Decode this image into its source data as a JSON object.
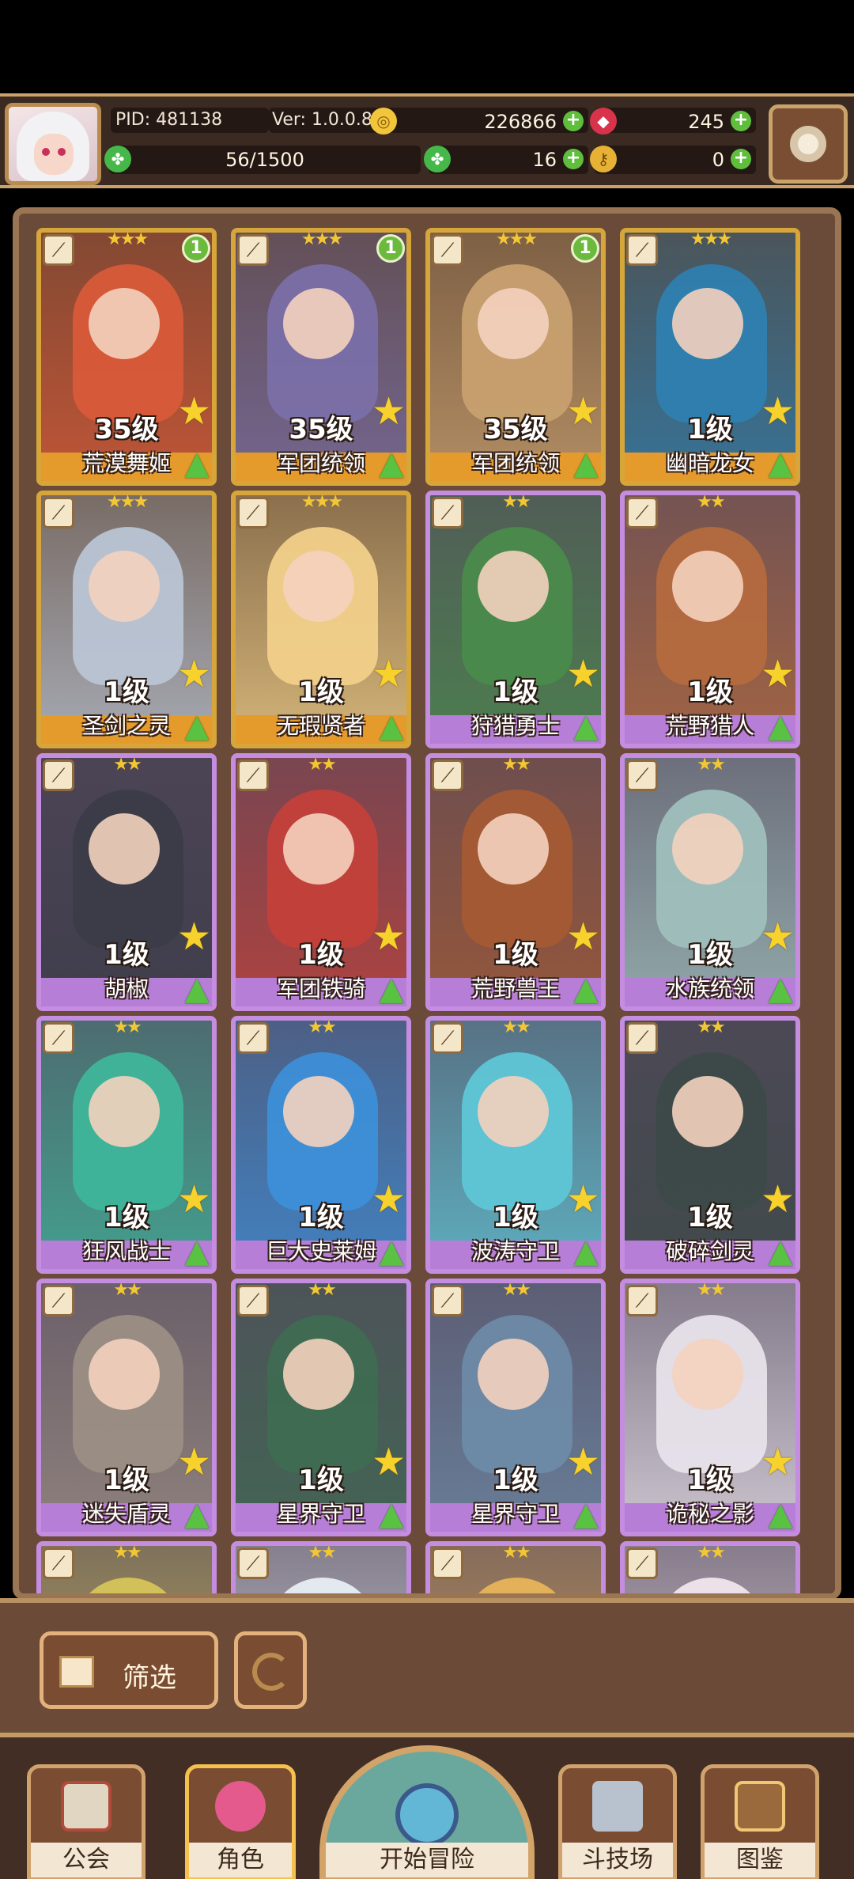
{
  "header": {
    "pid": "PID: 481138",
    "version": "Ver: 1.0.0.8",
    "gold": "226866",
    "gems": "245",
    "stamina": "56/1500",
    "clover": "16",
    "keys": "0",
    "plus": "+"
  },
  "icons": {
    "gold": "gold-coin-icon",
    "gem": "ruby-icon",
    "clover": "clover-icon",
    "key": "key-icon",
    "stamina": "stamina-clover-icon",
    "settings": "gear-icon"
  },
  "characters": [
    {
      "name": "荒漠舞姬",
      "level": "35级",
      "stars": "★★★",
      "badge": "1",
      "rarity": "gold",
      "tint": "#d85a3a"
    },
    {
      "name": "军团统领",
      "level": "35级",
      "stars": "★★★",
      "badge": "1",
      "rarity": "gold",
      "tint": "#7a6fa8"
    },
    {
      "name": "军团统领",
      "level": "35级",
      "stars": "★★★",
      "badge": "1",
      "rarity": "gold",
      "tint": "#c8a070"
    },
    {
      "name": "幽暗龙女",
      "level": "1级",
      "stars": "★★★",
      "badge": "",
      "rarity": "gold",
      "tint": "#2f7fb0"
    },
    {
      "name": "圣剑之灵",
      "level": "1级",
      "stars": "★★★",
      "badge": "",
      "rarity": "gold",
      "tint": "#b9c4d4"
    },
    {
      "name": "无瑕贤者",
      "level": "1级",
      "stars": "★★★",
      "badge": "",
      "rarity": "gold",
      "tint": "#f1d08a"
    },
    {
      "name": "狩猎勇士",
      "level": "1级",
      "stars": "★★",
      "badge": "",
      "rarity": "purple",
      "tint": "#4a8a4c"
    },
    {
      "name": "荒野猎人",
      "level": "1级",
      "stars": "★★",
      "badge": "",
      "rarity": "purple",
      "tint": "#b46a3e"
    },
    {
      "name": "胡椒",
      "level": "1级",
      "stars": "★★",
      "badge": "",
      "rarity": "purple",
      "tint": "#3b3c48"
    },
    {
      "name": "军团铁骑",
      "level": "1级",
      "stars": "★★",
      "badge": "",
      "rarity": "purple",
      "tint": "#c3413a"
    },
    {
      "name": "荒野兽王",
      "level": "1级",
      "stars": "★★",
      "badge": "",
      "rarity": "purple",
      "tint": "#a45a34"
    },
    {
      "name": "水族统领",
      "level": "1级",
      "stars": "★★",
      "badge": "",
      "rarity": "purple",
      "tint": "#9fbfbc"
    },
    {
      "name": "狂风战士",
      "level": "1级",
      "stars": "★★",
      "badge": "",
      "rarity": "purple",
      "tint": "#3fb59a"
    },
    {
      "name": "巨大史莱姆",
      "level": "1级",
      "stars": "★★",
      "badge": "",
      "rarity": "purple",
      "tint": "#3d8fd8"
    },
    {
      "name": "波涛守卫",
      "level": "1级",
      "stars": "★★",
      "badge": "",
      "rarity": "purple",
      "tint": "#5fc6d6"
    },
    {
      "name": "破碎剑灵",
      "level": "1级",
      "stars": "★★",
      "badge": "",
      "rarity": "purple",
      "tint": "#3c4a48"
    },
    {
      "name": "迷失盾灵",
      "level": "1级",
      "stars": "★★",
      "badge": "",
      "rarity": "purple",
      "tint": "#9b8e84"
    },
    {
      "name": "星界守卫",
      "level": "1级",
      "stars": "★★",
      "badge": "",
      "rarity": "purple",
      "tint": "#3f6b52"
    },
    {
      "name": "星界守卫",
      "level": "1级",
      "stars": "★★",
      "badge": "",
      "rarity": "purple",
      "tint": "#6d8aa6"
    },
    {
      "name": "诡秘之影",
      "level": "1级",
      "stars": "★★",
      "badge": "",
      "rarity": "purple",
      "tint": "#e7e2ea"
    },
    {
      "name": "",
      "level": "",
      "stars": "★★",
      "badge": "",
      "rarity": "purple",
      "tint": "#d6c55a"
    },
    {
      "name": "",
      "level": "",
      "stars": "★★",
      "badge": "",
      "rarity": "purple",
      "tint": "#e8eef2"
    },
    {
      "name": "",
      "level": "",
      "stars": "★★",
      "badge": "",
      "rarity": "purple",
      "tint": "#e8b45a"
    },
    {
      "name": "",
      "level": "",
      "stars": "★★",
      "badge": "",
      "rarity": "purple",
      "tint": "#f0e6ec"
    }
  ],
  "filter": {
    "label": "筛选"
  },
  "nav": {
    "guild": "公会",
    "character": "角色",
    "adventure": "开始冒险",
    "arena": "斗技场",
    "codex": "图鉴"
  }
}
